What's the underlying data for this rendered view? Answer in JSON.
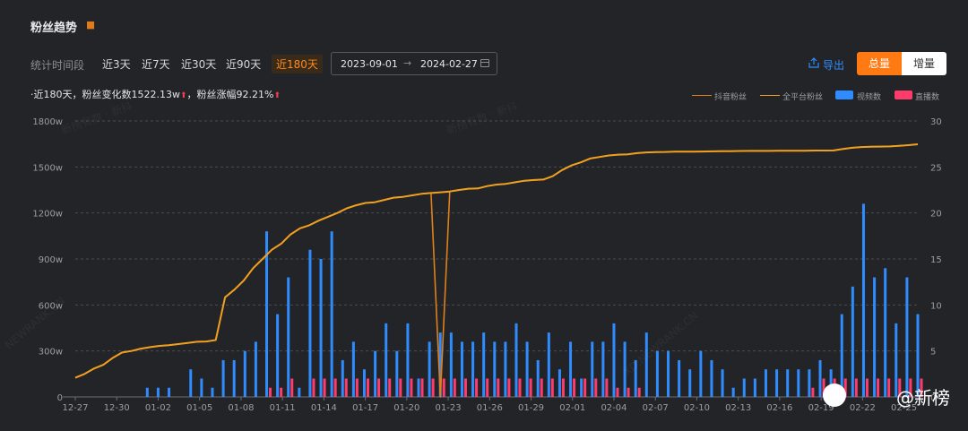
{
  "header": {
    "title": "粉丝趋势",
    "period_label": "统计时间段",
    "periods": [
      "近3天",
      "近7天",
      "近30天",
      "近90天",
      "近180天"
    ],
    "active_period": "近180天",
    "date_start": "2023-09-01",
    "date_end": "2024-02-27",
    "export_label": "导出",
    "toggle_total": "总量",
    "toggle_increment": "增量"
  },
  "summary": {
    "text1": "·近180天，粉丝变化数1522.13w",
    "text2": "，粉丝涨幅92.21%"
  },
  "legend": {
    "douyin": "抖音粉丝",
    "all_platform": "全平台粉丝",
    "videos": "视频数",
    "lives": "直播数"
  },
  "watermark": {
    "brand": "@新榜",
    "faint": [
      "新榜有数 · 新抖",
      "新榜有数 · 新抖",
      "NEWRANK.CN",
      "XD.NEWRANK.CN"
    ]
  },
  "colors": {
    "douyin_line": "#e0801a",
    "all_platform_line": "#f0a020",
    "video_bar": "#2f8cff",
    "live_bar": "#ff3b6b",
    "accent": "#ff7a12"
  },
  "chart_data": {
    "type": "bar",
    "x_ticks": [
      "12-27",
      "12-30",
      "01-02",
      "01-05",
      "01-08",
      "01-11",
      "01-14",
      "01-17",
      "01-20",
      "01-23",
      "01-26",
      "01-29",
      "02-01",
      "02-04",
      "02-07",
      "02-10",
      "02-13",
      "02-16",
      "02-19",
      "02-22",
      "02-25"
    ],
    "y_left_ticks": [
      "0",
      "300w",
      "600w",
      "900w",
      "1200w",
      "1500w",
      "1800w"
    ],
    "y_right_ticks": [
      "0",
      "5",
      "10",
      "15",
      "20",
      "25",
      "30"
    ],
    "ylim_left": [
      0,
      1800
    ],
    "ylim_right": [
      0,
      30
    ],
    "start_date": "12-27",
    "series": [
      {
        "name": "抖音粉丝",
        "axis": "left",
        "values": [
          125,
          150,
          185,
          210,
          255,
          290,
          300,
          315,
          325,
          333,
          338,
          345,
          352,
          360,
          362,
          371,
          650,
          700,
          760,
          840,
          900,
          960,
          1000,
          1060,
          1100,
          1120,
          1150,
          1175,
          1200,
          1230,
          1250,
          1265,
          1270,
          1285,
          1300,
          1305,
          1315,
          1325,
          1330,
          0,
          1340,
          1350,
          1358,
          1360,
          1375,
          1385,
          1390,
          1400,
          1410,
          1415,
          1418,
          1440,
          1480,
          1510,
          1530,
          1555,
          1565,
          1575,
          1580,
          1582,
          1590,
          1595,
          1597,
          1598,
          1600,
          1600,
          1600,
          1601,
          1602,
          1603,
          1603,
          1604,
          1605,
          1605,
          1605,
          1606,
          1606,
          1606,
          1606,
          1607,
          1607,
          1608,
          1617,
          1625,
          1630,
          1632,
          1633,
          1634,
          1638,
          1642,
          1648
        ]
      },
      {
        "name": "全平台粉丝",
        "axis": "left",
        "values": [
          125,
          150,
          185,
          210,
          255,
          290,
          300,
          315,
          325,
          333,
          338,
          345,
          352,
          360,
          362,
          371,
          650,
          700,
          760,
          840,
          900,
          960,
          1000,
          1060,
          1100,
          1120,
          1150,
          1175,
          1200,
          1230,
          1250,
          1265,
          1270,
          1285,
          1300,
          1305,
          1315,
          1325,
          1330,
          1335,
          1340,
          1350,
          1358,
          1360,
          1375,
          1385,
          1390,
          1400,
          1410,
          1415,
          1418,
          1440,
          1480,
          1510,
          1530,
          1555,
          1565,
          1575,
          1580,
          1582,
          1590,
          1595,
          1597,
          1598,
          1600,
          1600,
          1600,
          1601,
          1602,
          1603,
          1603,
          1604,
          1605,
          1605,
          1605,
          1606,
          1606,
          1606,
          1606,
          1607,
          1607,
          1608,
          1617,
          1625,
          1630,
          1632,
          1633,
          1634,
          1638,
          1642,
          1648
        ]
      },
      {
        "name": "视频数",
        "axis": "right",
        "values": [
          0,
          0,
          0,
          1,
          1,
          1,
          0,
          3,
          2,
          1,
          4,
          4,
          5,
          6,
          18,
          9,
          13,
          1,
          16,
          15,
          18,
          4,
          6,
          3,
          5,
          8,
          5,
          8,
          2,
          6,
          7,
          7,
          6,
          6,
          7,
          6,
          6,
          8,
          6,
          4,
          7,
          3,
          6,
          2,
          6,
          6,
          8,
          6,
          4,
          7,
          5,
          5,
          4,
          3,
          5,
          4,
          3,
          1,
          2,
          2,
          3,
          3,
          3,
          3,
          3,
          4,
          3,
          9,
          12,
          21,
          13,
          14,
          8,
          13,
          9
        ]
      },
      {
        "name": "直播数",
        "axis": "right",
        "values": [
          0,
          0,
          0,
          0,
          0,
          0,
          0,
          0,
          0,
          0,
          0,
          0,
          0,
          0,
          1,
          1,
          2,
          0,
          2,
          2,
          2,
          2,
          2,
          2,
          2,
          2,
          2,
          2,
          2,
          2,
          2,
          2,
          2,
          2,
          2,
          2,
          2,
          2,
          2,
          2,
          2,
          2,
          2,
          2,
          2,
          2,
          1,
          1,
          1,
          0,
          0,
          0,
          0,
          0,
          0,
          0,
          0,
          0,
          0,
          0,
          0,
          0,
          0,
          0,
          1,
          2,
          2,
          2,
          2,
          2,
          2,
          2,
          2,
          2,
          2
        ]
      }
    ]
  }
}
